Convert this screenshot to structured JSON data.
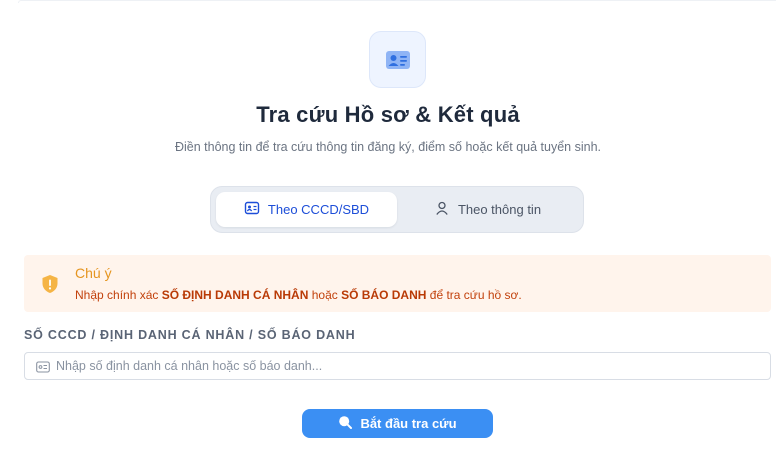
{
  "header": {
    "title": "Tra cứu Hồ sơ & Kết quả",
    "subtitle": "Điền thông tin để tra cứu thông tin đăng ký, điểm số hoặc kết quả tuyển sinh.",
    "icon": "id-card-icon"
  },
  "tabs": [
    {
      "label": "Theo CCCD/SBD",
      "icon": "id-card-icon",
      "active": true
    },
    {
      "label": "Theo thông tin",
      "icon": "user-icon",
      "active": false
    }
  ],
  "notice": {
    "title": "Chú ý",
    "text_before": "Nhập chính xác ",
    "highlight_1": "SỐ ĐỊNH DANH CÁ NHÂN",
    "text_middle": " hoặc ",
    "highlight_2": "SỐ BÁO DANH",
    "text_after": " để tra cứu hồ sơ.",
    "icon": "shield-warning-icon"
  },
  "form": {
    "label": "SỐ CCCD / ĐỊNH DANH CÁ NHÂN / SỐ BÁO DANH",
    "placeholder": "Nhập số định danh cá nhân hoặc số báo danh...",
    "value": ""
  },
  "submit": {
    "label": "Bắt đầu tra cứu",
    "icon": "search-icon"
  },
  "colors": {
    "primary": "#3b8ff3",
    "active_tab_text": "#1d4ed8",
    "notice_bg": "#fff4ec",
    "notice_title": "#e59520",
    "notice_text": "#c2410c"
  }
}
